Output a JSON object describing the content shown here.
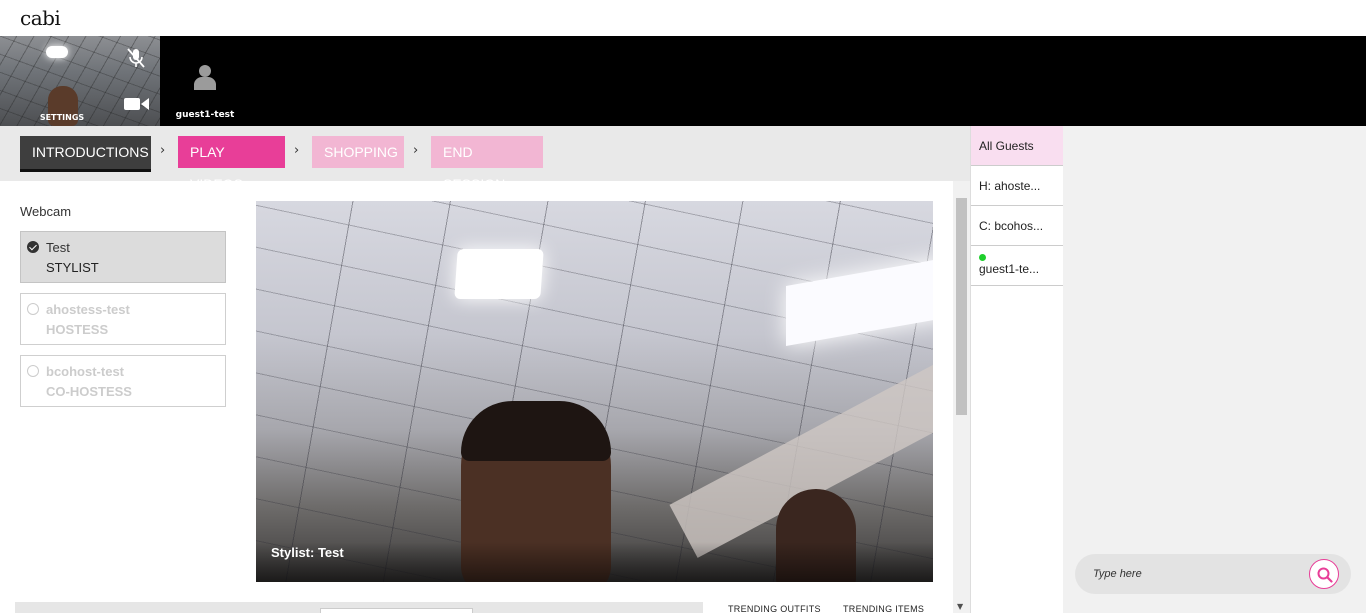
{
  "header": {
    "logo_text": "cabi"
  },
  "video_strip": {
    "self_label": "SETTINGS",
    "guest_name": "guest1-test",
    "icons": [
      "mic-muted-icon",
      "video-camera-icon",
      "person-icon"
    ]
  },
  "steps": [
    {
      "label": "INTRODUCTIONS",
      "state": "active"
    },
    {
      "label": "PLAY VIDEOS",
      "state": "next"
    },
    {
      "label": "SHOPPING",
      "state": "disabled"
    },
    {
      "label": "END SESSION",
      "state": "disabled"
    }
  ],
  "webcam": {
    "label": "Webcam",
    "participants": [
      {
        "name": "Test",
        "role": "STYLIST",
        "selected": true
      },
      {
        "name": "ahostess-test",
        "role": "HOSTESS",
        "selected": false
      },
      {
        "name": "bcohost-test",
        "role": "CO-HOSTESS",
        "selected": false
      }
    ]
  },
  "video": {
    "caption": "Stylist: Test"
  },
  "bottom_tabs": [
    "TRENDING OUTFITS",
    "TRENDING ITEMS"
  ],
  "guests": {
    "items": [
      {
        "label": "All Guests",
        "active": true
      },
      {
        "label": "H: ahoste...",
        "active": false
      },
      {
        "label": "C: bcohos...",
        "active": false
      },
      {
        "label": "guest1-te...",
        "active": false,
        "online": true
      }
    ]
  },
  "chat": {
    "placeholder": "Type here"
  },
  "colors": {
    "accent": "#e83e98",
    "accent_light": "#f2b6d3",
    "step_active": "#3e3e3e",
    "guest_active_bg": "#f9def0",
    "online": "#1ecf2c"
  }
}
